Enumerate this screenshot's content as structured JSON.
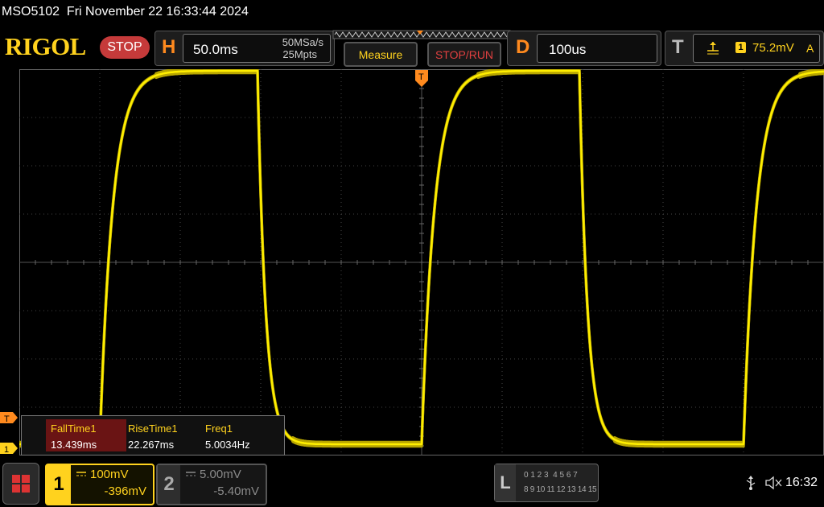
{
  "header": {
    "title": "MSO5102  Fri November 22 16:33:44 2024",
    "logo": "RIGOL",
    "run_state": "STOP"
  },
  "horizontal": {
    "letter": "H",
    "timebase": "50.0ms",
    "sample_rate": "50MSa/s",
    "memory_depth": "25Mpts"
  },
  "buttons": {
    "measure": "Measure",
    "stop_run": "STOP/RUN"
  },
  "delay": {
    "letter": "D",
    "value": "100us"
  },
  "trigger": {
    "letter": "T",
    "source": "1",
    "level": "75.2mV",
    "mode": "A"
  },
  "markers": {
    "trigger_top": "T",
    "trigger_level": "T",
    "channel1": "1"
  },
  "measurements": {
    "headers": [
      "FallTime1",
      "RiseTime1",
      "Freq1"
    ],
    "values": [
      "13.439ms",
      "22.267ms",
      "5.0034Hz"
    ]
  },
  "channels": [
    {
      "number": "1",
      "scale": "100mV",
      "offset": "-396mV",
      "color": "#ffd21e"
    },
    {
      "number": "2",
      "scale": "5.00mV",
      "offset": "-5.40mV",
      "color": "#8a8a8a"
    }
  ],
  "logic": {
    "letter": "L",
    "row1": "0 1 2 3  4 5 6 7",
    "row2": "8 9 10 11 12 13 14 15"
  },
  "status": {
    "time": "16:32"
  },
  "colors": {
    "trace": "#ffee00",
    "accent_orange": "#ff8a1e",
    "logo_yellow": "#ffd21e",
    "stop_red": "#c53a3a"
  },
  "icons": [
    "menu-grid-icon",
    "usb-icon",
    "speaker-muted-icon",
    "trigger-edge-icon"
  ]
}
